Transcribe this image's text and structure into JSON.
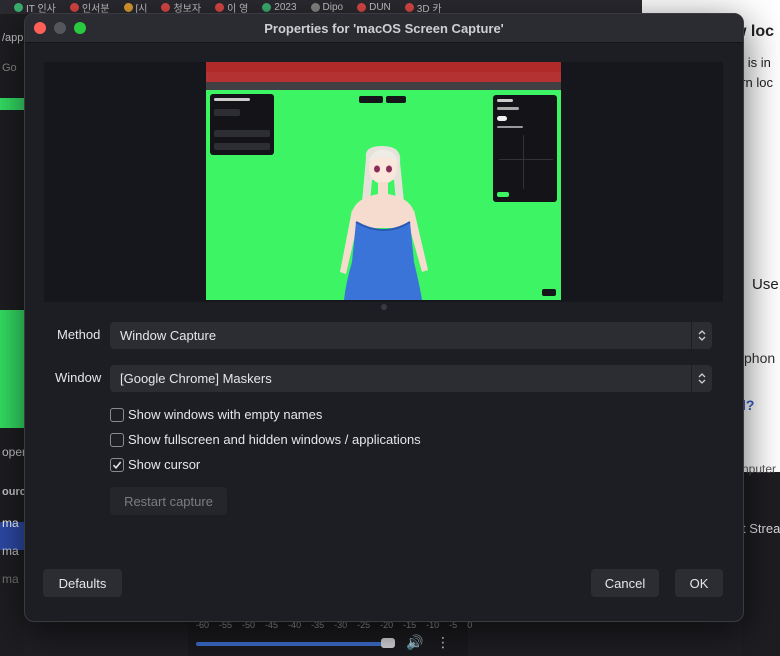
{
  "browser_tabs": [
    {
      "label": "IT 인사",
      "color": "#3cb371"
    },
    {
      "label": "인서분",
      "color": "#e04848"
    },
    {
      "label": "[시",
      "color": "#e0a030"
    },
    {
      "label": "청보자",
      "color": "#e04848"
    },
    {
      "label": "이 영",
      "color": "#e04848"
    },
    {
      "label": "2023",
      "color": "#3cb371"
    },
    {
      "label": "Dipo",
      "color": "#888888"
    },
    {
      "label": "DUN",
      "color": "#e04848"
    },
    {
      "label": "3D 카",
      "color": "#e04848"
    }
  ],
  "bg_left": {
    "url_fragment": "/app",
    "tab_g": "Go",
    "prop_fragment": "oper",
    "source_fragment": "ourc",
    "item1": "ma",
    "item2": "ma",
    "item3": "ma"
  },
  "bg_right": {
    "line1": "w loc",
    "line2": "le is in",
    "line3": "ern loc",
    "line4": "Use",
    "line5": "phon",
    "line6": "l?",
    "line7": "nputer",
    "line8": "t Strea"
  },
  "bg_bottom": {
    "ticks": [
      "-60",
      "-55",
      "-50",
      "-45",
      "-40",
      "-35",
      "-30",
      "-25",
      "-20",
      "-15",
      "-10",
      "-5",
      "0"
    ],
    "volume_level": 0.96
  },
  "dialog": {
    "title": "Properties for 'macOS Screen Capture'",
    "method_label": "Method",
    "method_value": "Window Capture",
    "window_label": "Window",
    "window_value": "[Google Chrome] Maskers",
    "checkboxes": [
      {
        "label": "Show windows with empty names",
        "checked": false
      },
      {
        "label": "Show fullscreen and hidden windows / applications",
        "checked": false
      },
      {
        "label": "Show cursor",
        "checked": true
      }
    ],
    "restart_label": "Restart capture",
    "defaults_label": "Defaults",
    "cancel_label": "Cancel",
    "ok_label": "OK"
  },
  "colors": {
    "preview_green": "#3df564",
    "dress_blue": "#3a74d8",
    "close_red": "#fe5f57",
    "zoom_green": "#2ac940"
  }
}
